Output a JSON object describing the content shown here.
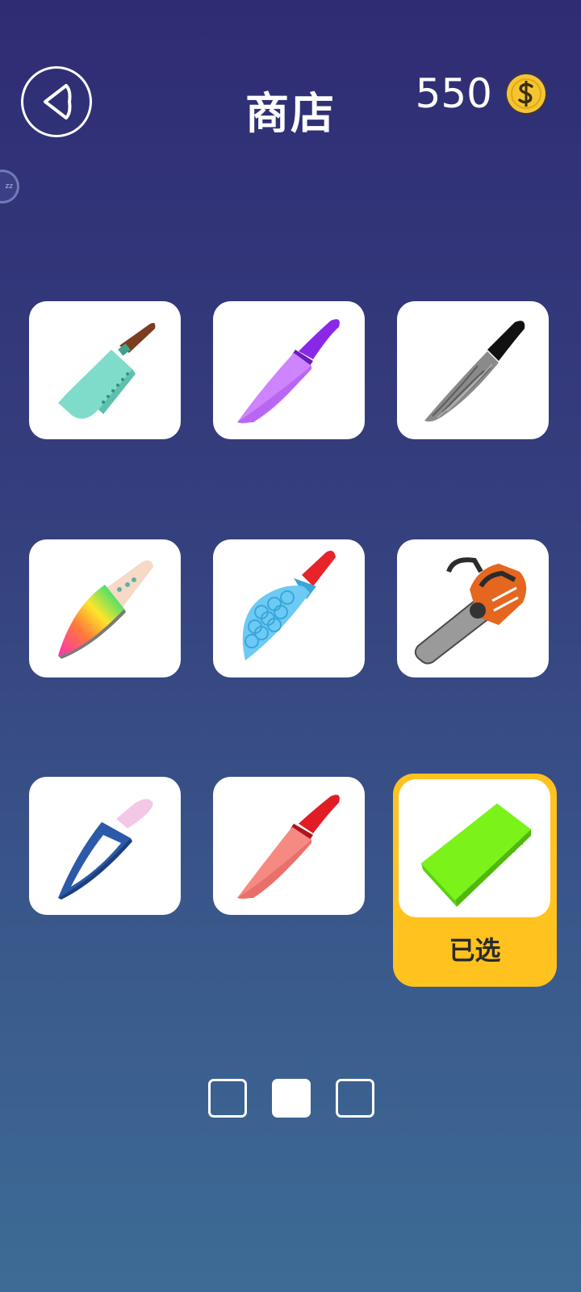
{
  "header": {
    "title": "商店",
    "coin_count": "550",
    "back_icon": "back-arrow-icon",
    "coin_icon": "dollar-coin-icon"
  },
  "side_badge": {
    "text": "zz"
  },
  "shop": {
    "selected_label": "已选",
    "items": [
      {
        "name": "teal-cleaver",
        "selected": false
      },
      {
        "name": "purple-chef-knife",
        "selected": false
      },
      {
        "name": "damascus-black-handle-knife",
        "selected": false
      },
      {
        "name": "rainbow-knife",
        "selected": false
      },
      {
        "name": "blue-scale-knife",
        "selected": false
      },
      {
        "name": "chainsaw",
        "selected": false
      },
      {
        "name": "blue-hollow-knife",
        "selected": false
      },
      {
        "name": "salmon-red-handle-knife",
        "selected": false
      },
      {
        "name": "green-ruler-blade",
        "selected": true
      }
    ]
  },
  "pagination": {
    "pages": 3,
    "current": 2
  },
  "colors": {
    "accent": "#ffc21e",
    "coin": "#f5c531"
  }
}
